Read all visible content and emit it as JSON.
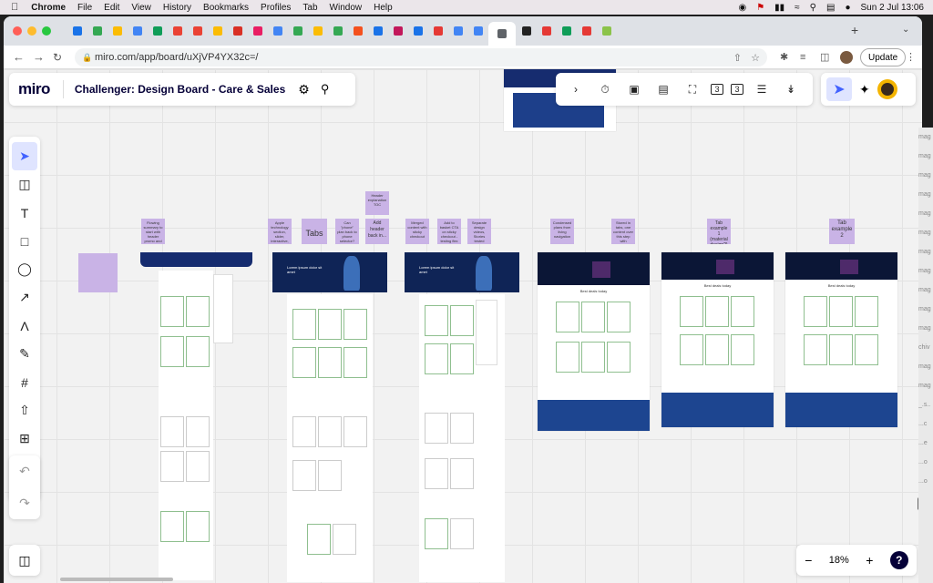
{
  "menubar": {
    "app": "Chrome",
    "items": [
      "File",
      "Edit",
      "View",
      "History",
      "Bookmarks",
      "Profiles",
      "Tab",
      "Window",
      "Help"
    ],
    "clock": "Sun 2 Jul  13:06"
  },
  "browser": {
    "url": "miro.com/app/board/uXjVP4YX32c=/",
    "update_label": "Update",
    "tab_colors": [
      "#1a73e8",
      "#34a853",
      "#fbbc04",
      "#4285f4",
      "#0f9d58",
      "#ea4335",
      "#ea4335",
      "#fbbc04",
      "#d93025",
      "#e91e63",
      "#4285f4",
      "#34a853",
      "#fbbc04",
      "#34a853",
      "#f4511e",
      "#1a73e8",
      "#c2185b",
      "#1a73e8",
      "#e53935",
      "#4285f4",
      "#4285f4",
      "#5f6368",
      "#222222",
      "#e53935",
      "#0f9d58",
      "#e53935",
      "#8bc34a"
    ]
  },
  "miro": {
    "logo": "miro",
    "board_title": "Challenger: Design Board - Care & Sales",
    "zoom_level": "18%",
    "help_label": "?",
    "toolbar_badges": [
      "3",
      "3"
    ]
  },
  "stickies": [
    {
      "text": "Header explanation TOC"
    },
    {
      "text": "Flowing summary to start with header promo and plan"
    },
    {
      "text": "Apple technology section, slider, interactive, feature header in this area"
    },
    {
      "text": "Tabs"
    },
    {
      "text": "Can \"phone\" plan back to phone selector?"
    },
    {
      "text": "Add header back in..."
    },
    {
      "text": "Merged content with sticky checkout"
    },
    {
      "text": "Add to basket CTA on sticky checkout - testing flex"
    },
    {
      "text": "Separate design videos, Stories tested together on new page"
    },
    {
      "text": "Condensed plans from living navigation"
    },
    {
      "text": "Stored in tabs, one content over this step with marketing details"
    },
    {
      "text": "Tab example 1 (material design?)"
    },
    {
      "text": "Tab example 2"
    },
    {
      "text": ""
    }
  ],
  "frames": {
    "hero_text": "Lorem ipsum dolor sit amet",
    "section_title": "Best deals today"
  },
  "edge_text": [
    "mag",
    "mag",
    "mag",
    "mag",
    "mag",
    "mag",
    "mag",
    "mag",
    "mag",
    "mag",
    "mag",
    "chiv",
    "mag",
    "mag",
    "_.s..",
    "...c",
    "...e",
    "...o",
    "...o"
  ]
}
